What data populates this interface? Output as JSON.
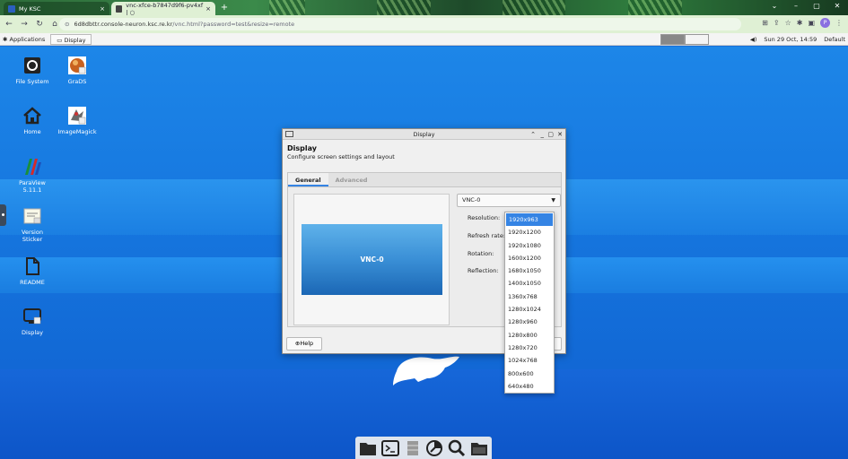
{
  "browser": {
    "tabs": [
      {
        "title": "My KSC",
        "close": "×"
      },
      {
        "title": "vnc-xfce-b7847d9f6-pv4xf | ○",
        "close": "×"
      }
    ],
    "new_tab": "+",
    "url_host": "6d8dbttr.console-neuron.ksc.re.kr",
    "url_path": "/vnc.html?password=test&resize=remote",
    "profile_initial": "P"
  },
  "panel": {
    "applications": "Applications",
    "task": "Display",
    "clock": "Sun 29 Oct, 14:59",
    "user": "Default"
  },
  "desktop_icons": [
    {
      "label": "File System",
      "icon": "drive-icon"
    },
    {
      "label": "GraDS",
      "icon": "grads-icon"
    },
    {
      "label": "Home",
      "icon": "home-icon"
    },
    {
      "label": "ImageMagick",
      "icon": "imagemagick-icon"
    },
    {
      "label": "ParaView 5.11.1",
      "label_lines": [
        "ParaView",
        "5.11.1"
      ],
      "icon": "paraview-icon"
    },
    {
      "label": "Version Sticker",
      "label_lines": [
        "Version",
        "Sticker"
      ],
      "icon": "sticker-icon"
    },
    {
      "label": "README",
      "icon": "document-icon"
    },
    {
      "label": "Display",
      "icon": "display-icon"
    }
  ],
  "dialog": {
    "window_title": "Display",
    "heading": "Display",
    "subtitle": "Configure screen settings and layout",
    "tabs": [
      "General",
      "Advanced"
    ],
    "active_tab": "General",
    "monitor_label": "VNC-0",
    "output_select": "VNC-0",
    "fields": {
      "resolution": "Resolution:",
      "refresh_rate": "Refresh rate:",
      "rotation": "Rotation:",
      "reflection": "Reflection:"
    },
    "help_button": "Help",
    "close_button_partial": "e"
  },
  "resolution_options": [
    "1920x963",
    "1920x1200",
    "1920x1080",
    "1600x1200",
    "1680x1050",
    "1400x1050",
    "1360x768",
    "1280x1024",
    "1280x960",
    "1280x800",
    "1280x720",
    "1024x768",
    "800x600",
    "640x480"
  ],
  "selected_resolution": "1920x963",
  "colors": {
    "accent": "#3584e4",
    "desktop": "#1677df",
    "browser_chrome": "#dff0d4"
  }
}
